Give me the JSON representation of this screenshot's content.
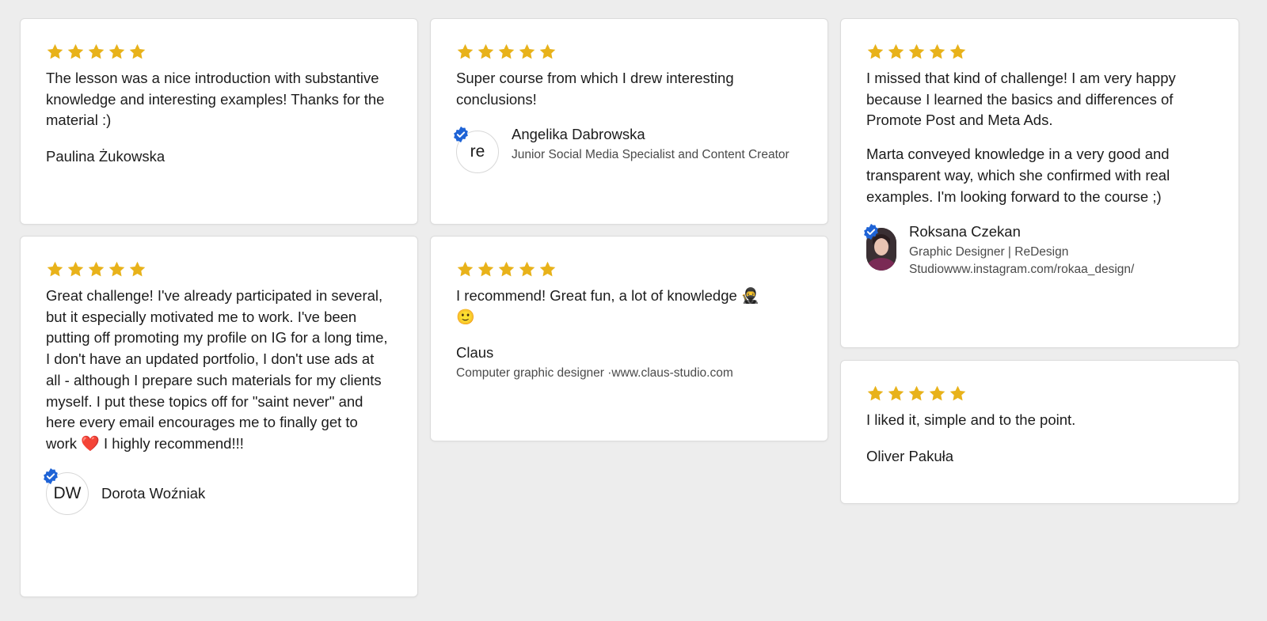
{
  "colors": {
    "star": "#e8b21a",
    "verified": "#1e63d6",
    "background": "#ededed",
    "card": "#ffffff"
  },
  "icons": {
    "rating": "star-icon",
    "verified": "verified-badge-icon"
  },
  "reviews": [
    {
      "rating": 5,
      "paragraphs": [
        "The lesson was a nice introduction with substantive knowledge and interesting examples! Thanks for the material :)"
      ],
      "author": "Paulina Żukowska"
    },
    {
      "rating": 5,
      "paragraphs": [
        "Super course from which I drew interesting conclusions!"
      ],
      "author": "Angelika Dabrowska",
      "initials": "re",
      "role": "Junior Social Media Specialist and Content Creator"
    },
    {
      "rating": 5,
      "paragraphs": [
        "I missed that kind of challenge! I am very happy because I learned the basics and differences of Promote Post and Meta Ads.",
        "Marta conveyed knowledge in a very good and transparent way, which she confirmed with real examples. I'm looking forward to the course ;)"
      ],
      "author": "Roksana Czekan",
      "role": "Graphic Designer | ReDesign Studiowww.instagram.com/rokaa_design/"
    },
    {
      "rating": 5,
      "text_before_emoji": "Great challenge! I've already participated in several, but it especially motivated me to work. I've been putting off promoting my profile on IG for a long time, I don't have an updated portfolio, I don't use ads at all - although I prepare such materials for my clients myself. I put these topics off for \"saint never\" and here every email encourages me to finally get to work ",
      "emoji": "❤️",
      "text_after_emoji": " I highly recommend!!!",
      "author": "Dorota Woźniak",
      "initials": "DW"
    },
    {
      "rating": 5,
      "text_before_emoji": "I recommend! Great fun, a lot of knowledge ",
      "emoji": "🥷",
      "emoji2": "🙂",
      "author": "Claus",
      "role": "Computer graphic designer ·www.claus-studio.com"
    },
    {
      "rating": 5,
      "paragraphs": [
        "I liked it, simple and to the point."
      ],
      "author": "Oliver Pakuła"
    }
  ]
}
